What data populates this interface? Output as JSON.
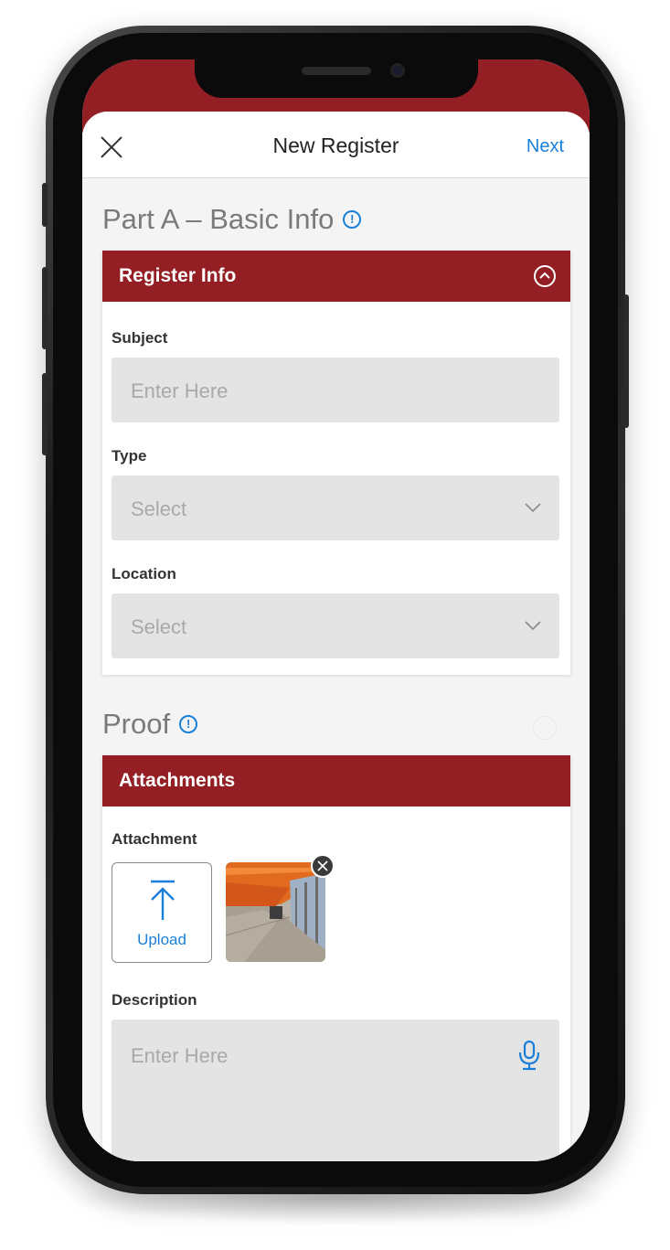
{
  "nav": {
    "title": "New Register",
    "next_label": "Next"
  },
  "part_a": {
    "title": "Part A – Basic Info",
    "info_glyph": "!",
    "card_title": "Register Info",
    "fields": [
      {
        "label": "Subject",
        "placeholder": "Enter Here",
        "kind": "text"
      },
      {
        "label": "Type",
        "placeholder": "Select",
        "kind": "select"
      },
      {
        "label": "Location",
        "placeholder": "Select",
        "kind": "select"
      }
    ]
  },
  "proof": {
    "title": "Proof",
    "info_glyph": "!",
    "card_title": "Attachments",
    "attachment_label": "Attachment",
    "upload_label": "Upload",
    "description_label": "Description",
    "description_placeholder": "Enter Here"
  },
  "colors": {
    "brand": "#931f25",
    "accent": "#1a7fd8",
    "field_bg": "#e4e4e4"
  },
  "icons": [
    "close-icon",
    "info-icon",
    "collapse-up-icon",
    "chevron-down-icon",
    "upload-icon",
    "remove-icon",
    "microphone-icon"
  ]
}
